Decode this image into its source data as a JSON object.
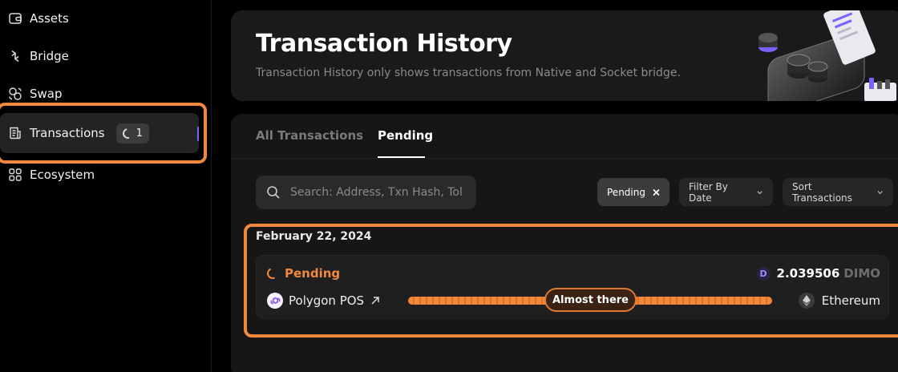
{
  "sidebar": {
    "items": [
      {
        "label": "Assets",
        "icon": "wallet-icon"
      },
      {
        "label": "Bridge",
        "icon": "bridge-icon"
      },
      {
        "label": "Swap",
        "icon": "swap-icon"
      },
      {
        "label": "Transactions",
        "icon": "receipt-icon",
        "badge_count": "1",
        "active": true
      },
      {
        "label": "Ecosystem",
        "icon": "grid-icon"
      }
    ]
  },
  "header": {
    "title": "Transaction History",
    "subtitle": "Transaction History only shows transactions from Native and Socket bridge."
  },
  "tabs": [
    {
      "label": "All Transactions",
      "active": false
    },
    {
      "label": "Pending",
      "active": true
    }
  ],
  "search": {
    "placeholder": "Search: Address, Txn Hash, Tol"
  },
  "filters": {
    "active_chip": "Pending",
    "date_filter": "Filter By Date",
    "sort": "Sort Transactions"
  },
  "transactions": {
    "date": "February 22, 2024",
    "items": [
      {
        "status": "Pending",
        "token_icon_letter": "D",
        "amount": "2.039506",
        "token": "DIMO",
        "from_chain": "Polygon POS",
        "to_chain": "Ethereum",
        "progress_label": "Almost there"
      }
    ]
  },
  "colors": {
    "accent_orange": "#f0883e",
    "active_indicator": "#7b61ff",
    "background": "#000000",
    "card": "#1a1a1a"
  }
}
